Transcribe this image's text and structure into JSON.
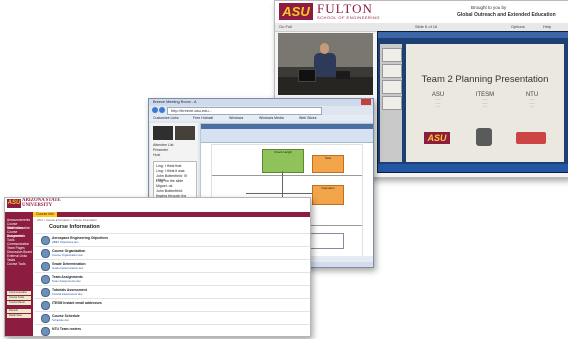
{
  "fulton": {
    "logo": "ASU",
    "name": "FULTON",
    "prefix": "Ira A.",
    "subtitle": "SCHOOL OF ENGINEERING",
    "brought_by": "Brought to you by",
    "org": "Global Outreach and Extended Education",
    "toolbar": {
      "left": "Go Full",
      "slide_counter": "Slide 6 of 16",
      "options": "Options",
      "help": "Help"
    },
    "slide": {
      "title": "Team 2 Planning Presentation",
      "columns": [
        {
          "name": "ASU"
        },
        {
          "name": "ITESM"
        },
        {
          "name": "NTU"
        }
      ],
      "logo": "ASU"
    }
  },
  "browser": {
    "title": "Breeze Meeting Room - A",
    "url": "http://breeze.asu.edu...",
    "bookmarks": [
      "Customize Links",
      "Free Hotmail",
      "Windows",
      "Windows Media",
      "Web Slices"
    ],
    "left_list": [
      "Attendee List",
      "Presenter",
      "Host"
    ],
    "chat": [
      "Ling: I think that",
      "Ling: I think it was",
      "John Bottenfield: I'll check",
      "Ling: on the slide",
      "Miguel: ok",
      "John Bottenfield:",
      "flowing through the",
      "process..."
    ],
    "flowchart": {
      "boxes": [
        "Check Height",
        "Task",
        "Operation",
        "Decision"
      ]
    }
  },
  "course": {
    "logo": "ASU",
    "name_line1": "ARIZONA STATE",
    "name_line2": "UNIVERSITY",
    "nav_tab": "Course Info",
    "breadcrumb": "ASU > Course Information > Course Information",
    "title": "Course Information",
    "sidebar": [
      "Announcements",
      "Course Information",
      "Staff Information",
      "Course Documents",
      "Assignments",
      "Tools",
      "Communication",
      "Team Pages",
      "Discussion Board",
      "External Links",
      "Tasks",
      "Course Tools"
    ],
    "sidebar_buttons": [
      "Communication",
      "Course Tools",
      "Control Panel",
      "Refresh",
      "Detail View"
    ],
    "rows": [
      {
        "title": "Aerospace Engineering Objectives",
        "link": "ABET Objectives.doc"
      },
      {
        "title": "Course Organization",
        "link": "Course Organization.doc"
      },
      {
        "title": "Grade Determination",
        "link": "Grade Determination.doc"
      },
      {
        "title": "Team Assignments",
        "link": "Team Assignments.doc"
      },
      {
        "title": "Tutorials Assessment",
        "link": "Tutorial Assessment.doc"
      },
      {
        "title": "ITESM Instant email addresses",
        "link": ""
      },
      {
        "title": "Course Schedule",
        "link": "Schedule.doc"
      },
      {
        "title": "NTU Team rosters",
        "link": ""
      }
    ]
  }
}
